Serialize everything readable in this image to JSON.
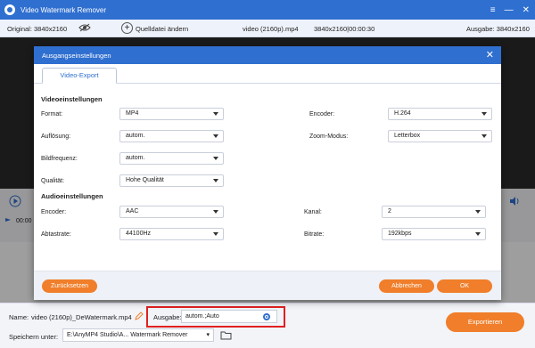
{
  "app": {
    "title": "Video Watermark Remover"
  },
  "info": {
    "original": "Original: 3840x2160",
    "change_source": "Quelldatei ändern",
    "file": "video (2160p).mp4",
    "meta": "3840x2160|00:00:30",
    "output": "Ausgabe: 3840x2160"
  },
  "player": {
    "time": "00:00"
  },
  "dialog": {
    "title": "Ausgangseinstellungen",
    "tab": "Video-Export",
    "video_section": "Videoeinstellungen",
    "audio_section": "Audioeinstellungen",
    "format": {
      "label": "Format:",
      "value": "MP4"
    },
    "encoder": {
      "label": "Encoder:",
      "value": "H.264"
    },
    "resolution": {
      "label": "Auflösung:",
      "value": "autom."
    },
    "zoom": {
      "label": "Zoom-Modus:",
      "value": "Letterbox"
    },
    "framerate": {
      "label": "Bildfrequenz:",
      "value": "autom."
    },
    "quality": {
      "label": "Qualität:",
      "value": "Hohe Qualität"
    },
    "audio_encoder": {
      "label": "Encoder:",
      "value": "AAC"
    },
    "channel": {
      "label": "Kanal:",
      "value": "2"
    },
    "samplerate": {
      "label": "Abtastrate:",
      "value": "44100Hz"
    },
    "bitrate": {
      "label": "Bitrate:",
      "value": "192kbps"
    },
    "reset": "Zurücksetzen",
    "cancel": "Abbrechen",
    "ok": "OK"
  },
  "footer": {
    "name_label": "Name:",
    "name_value": "video (2160p)_DeWatermark.mp4",
    "output_label": "Ausgabe:",
    "output_value": "autom.;Auto",
    "save_label": "Speichern unter:",
    "save_path": "E:\\AnyMP4 Studio\\A... Watermark Remover",
    "export": "Exportieren"
  },
  "colors": {
    "accent": "#2f6fd0",
    "orange": "#f07e2a",
    "highlight": "#e02020"
  }
}
